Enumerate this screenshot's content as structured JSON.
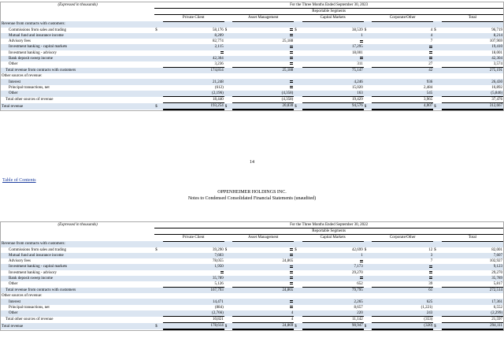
{
  "page_number": "14",
  "toc_link": "Table of Contents",
  "company": "OPPENHEIMER HOLDINGS INC.",
  "notes_title": "Notes to Condensed Consolidated Financial Statements (unaudited)",
  "table1": {
    "units": "(Expressed in thousands)",
    "period": "For the Three Months Ended September 30, 2023",
    "segments_label": "Reportable Segments",
    "columns": [
      "Private Client",
      "Asset Management",
      "Capital Markets",
      "Corporate/Other",
      "Total"
    ],
    "rows": [
      {
        "label": "Revenue from contracts with customers:",
        "type": "section",
        "vals": [
          "",
          "",
          "",
          "",
          ""
        ]
      },
      {
        "label": "Commissions from sales and trading",
        "type": "item",
        "dollar": true,
        "vals": [
          "58,176",
          "—",
          "38,539",
          "4",
          "96,719"
        ]
      },
      {
        "label": "Mutual fund and insurance income",
        "type": "item",
        "vals": [
          "8,209",
          "—",
          "1",
          "4",
          "8,214"
        ]
      },
      {
        "label": "Advisory fees",
        "type": "item",
        "vals": [
          "82,774",
          "25,188",
          "—",
          "7",
          "107,969"
        ]
      },
      {
        "label": "Investment banking - capital markets",
        "type": "item",
        "vals": [
          "2,115",
          "—",
          "17,295",
          "—",
          "19,410"
        ]
      },
      {
        "label": "Investment banking - advisory",
        "type": "item",
        "vals": [
          "—",
          "—",
          "18,001",
          "—",
          "18,001"
        ]
      },
      {
        "label": "Bank deposit sweep income",
        "type": "item",
        "vals": [
          "42,304",
          "—",
          "—",
          "—",
          "42,304"
        ]
      },
      {
        "label": "Other",
        "type": "item",
        "ul": true,
        "vals": [
          "3,236",
          "—",
          "311",
          "27",
          "3,574"
        ]
      },
      {
        "label": "Total revenue from contracts with customers",
        "type": "total",
        "vals": [
          "174,814",
          "25,188",
          "75,147",
          "42",
          "275,191"
        ]
      },
      {
        "label": "Other sources of revenue:",
        "type": "section",
        "vals": [
          "",
          "",
          "",
          "",
          ""
        ]
      },
      {
        "label": "Interest",
        "type": "item",
        "vals": [
          "21,248",
          "—",
          "4,246",
          "936",
          "26,430"
        ]
      },
      {
        "label": "Principal transactions, net",
        "type": "item",
        "vals": [
          "(612)",
          "—",
          "15,020",
          "2,484",
          "16,892"
        ]
      },
      {
        "label": "Other",
        "type": "item",
        "ul": true,
        "vals": [
          "(2,196)",
          "(4,358)",
          "163",
          "545",
          "(5,846)"
        ]
      },
      {
        "label": "Total other sources of revenue",
        "type": "total",
        "ul": true,
        "vals": [
          "18,440",
          "(4,358)",
          "19,429",
          "3,965",
          "37,476"
        ]
      },
      {
        "label": "Total revenue",
        "type": "grand",
        "dollar": true,
        "vals": [
          "193,254",
          "20,830",
          "94,576",
          "4,007",
          "312,667"
        ]
      }
    ]
  },
  "table2": {
    "units": "(Expressed in thousands)",
    "period": "For the Three Months Ended September 30, 2022",
    "segments_label": "Reportable Segments",
    "columns": [
      "Private Client",
      "Asset Management",
      "Capital Markets",
      "Corporate/Other",
      "Total"
    ],
    "rows": [
      {
        "label": "Revenue from contracts with customers:",
        "type": "section",
        "vals": [
          "",
          "",
          "",
          "",
          ""
        ]
      },
      {
        "label": "Commissions from sales and trading",
        "type": "item",
        "dollar": true,
        "vals": [
          "39,290",
          "—",
          "42,699",
          "12",
          "82,001"
        ]
      },
      {
        "label": "Mutual fund and insurance income",
        "type": "item",
        "vals": [
          "7,603",
          "—",
          "1",
          "3",
          "7,607"
        ]
      },
      {
        "label": "Advisory fees",
        "type": "item",
        "vals": [
          "78,055",
          "24,865",
          "—",
          "7",
          "102,927"
        ]
      },
      {
        "label": "Investment banking - capital markets",
        "type": "item",
        "vals": [
          "1,950",
          "—",
          "7,173",
          "—",
          "9,123"
        ]
      },
      {
        "label": "Investment banking - advisory",
        "type": "item",
        "vals": [
          "—",
          "—",
          "29,270",
          "—",
          "29,270"
        ]
      },
      {
        "label": "Bank deposit sweep income",
        "type": "item",
        "vals": [
          "35,789",
          "—",
          "—",
          "—",
          "35,789"
        ]
      },
      {
        "label": "Other",
        "type": "item",
        "ul": true,
        "vals": [
          "5,126",
          "—",
          "652",
          "39",
          "5,817"
        ]
      },
      {
        "label": "Total revenue from contracts with customers",
        "type": "total",
        "vals": [
          "167,793",
          "24,865",
          "79,795",
          "61",
          "272,514"
        ]
      },
      {
        "label": "Other sources of revenue:",
        "type": "section",
        "vals": [
          "",
          "",
          "",
          "",
          ""
        ]
      },
      {
        "label": "Interest",
        "type": "item",
        "vals": [
          "14,471",
          "—",
          "2,265",
          "625",
          "17,361"
        ]
      },
      {
        "label": "Principal transactions, net",
        "type": "item",
        "vals": [
          "(884)",
          "—",
          "8,657",
          "(1,221)",
          "6,552"
        ]
      },
      {
        "label": "Other",
        "type": "item",
        "ul": true,
        "vals": [
          "(2,766)",
          "4",
          "220",
          "243",
          "(2,299)"
        ]
      },
      {
        "label": "Total other sources of revenue",
        "type": "total",
        "ul": true,
        "vals": [
          "10,821",
          "4",
          "11,142",
          "(353)",
          "21,597"
        ]
      },
      {
        "label": "Total revenue",
        "type": "grand",
        "dollar": true,
        "vals": [
          "178,614",
          "24,869",
          "90,947",
          "(320)",
          "294,111"
        ]
      }
    ]
  }
}
